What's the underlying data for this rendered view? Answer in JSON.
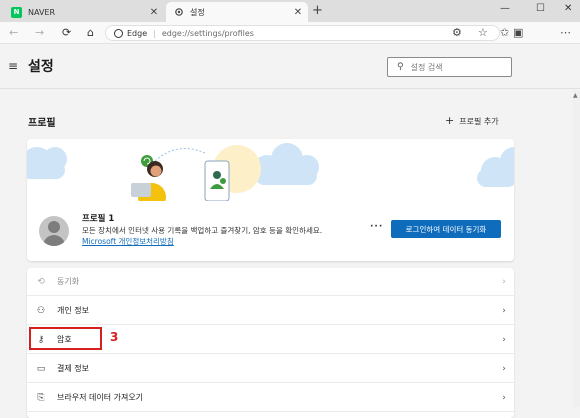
{
  "tabs": [
    {
      "title": "NAVER",
      "favicon": "naver-logo",
      "close": "✕",
      "favicon_text": "N"
    },
    {
      "title": "설정",
      "favicon": "gear-icon",
      "close": "✕"
    }
  ],
  "new_tab": "+",
  "window_controls": {
    "minimize": "—",
    "maximize": "☐",
    "close": "✕"
  },
  "address_bar": {
    "identity": "Edge",
    "separator": "|",
    "url": "edge://settings/profiles"
  },
  "settings_header": {
    "title": "설정",
    "search_placeholder": "설정 검색"
  },
  "profiles_section": {
    "title": "프로필",
    "add_profile_label": "프로필 추가",
    "profile": {
      "name": "프로필 1",
      "description": "모든 장치에서 인터넷 사용 기록을 백업하고 즐겨찾기, 암호 등을 확인하세요.",
      "privacy_link": "Microsoft 개인정보처리방침",
      "more_label": "···",
      "signin_button": "로그인하여 데이터 동기화"
    }
  },
  "menu_items": [
    {
      "label": "동기화",
      "icon": "sync-icon",
      "disabled": true
    },
    {
      "label": "개인 정보",
      "icon": "person-icon",
      "disabled": false
    },
    {
      "label": "암호",
      "icon": "key-icon",
      "disabled": false
    },
    {
      "label": "결제 정보",
      "icon": "card-icon",
      "disabled": false
    },
    {
      "label": "브라우저 데이터 가져오기",
      "icon": "import-icon",
      "disabled": false
    }
  ],
  "annotation": {
    "step": "3",
    "color": "#d62020"
  },
  "colors": {
    "accent": "#0f6cbd",
    "naver": "#03c75a"
  }
}
